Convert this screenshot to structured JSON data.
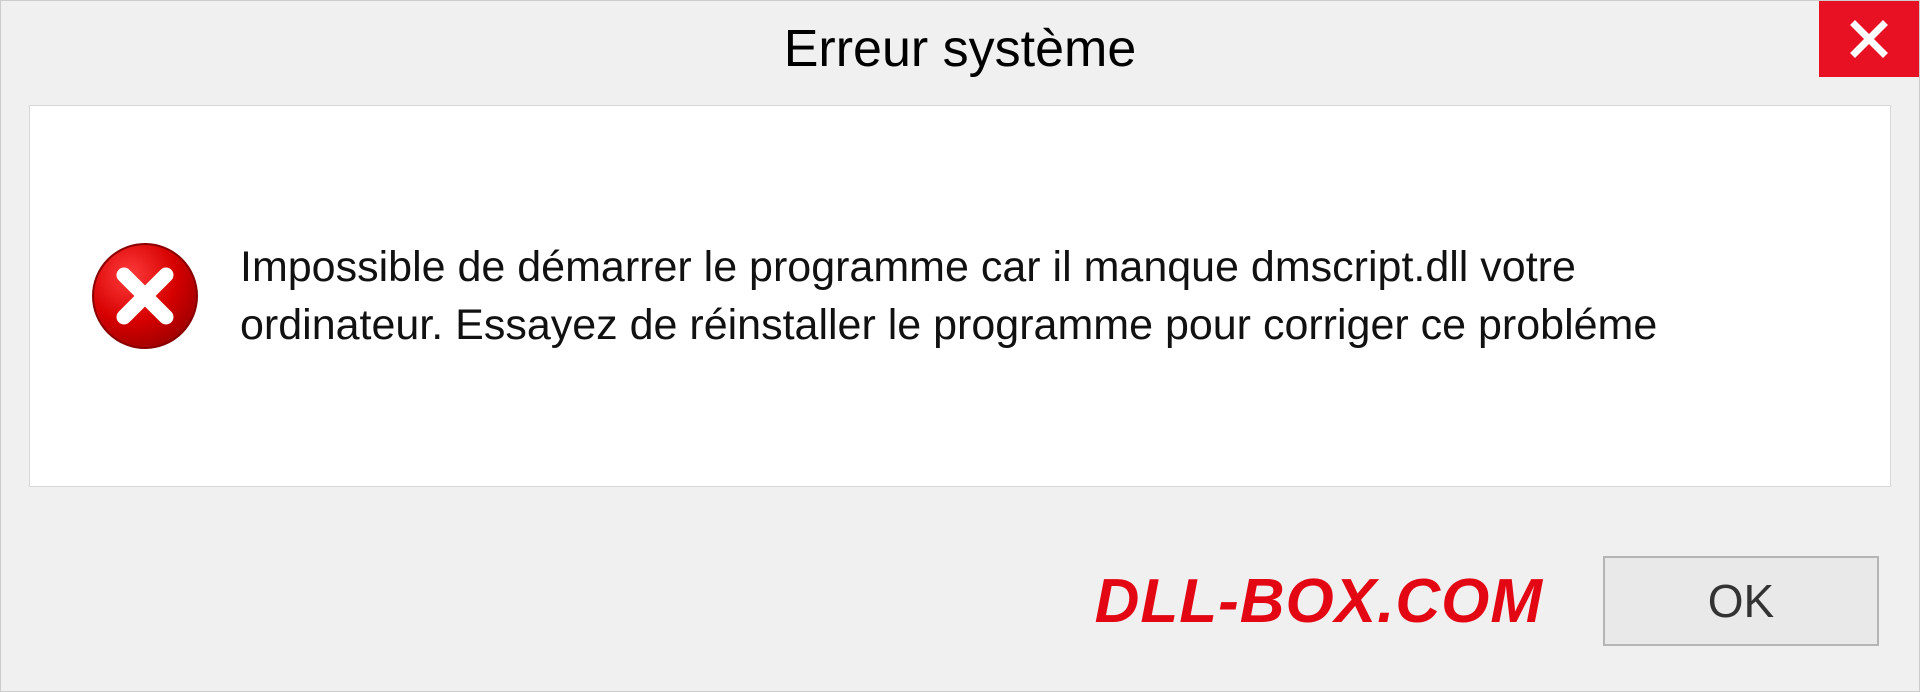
{
  "dialog": {
    "title": "Erreur système",
    "message": "Impossible de démarrer le programme car il manque dmscript.dll votre ordinateur. Essayez de réinstaller le programme pour corriger ce probléme",
    "ok_label": "OK"
  },
  "brand": {
    "text": "DLL-BOX.COM"
  },
  "colors": {
    "close_bg": "#e81123",
    "error_icon": "#d60000",
    "brand": "#e30613"
  }
}
